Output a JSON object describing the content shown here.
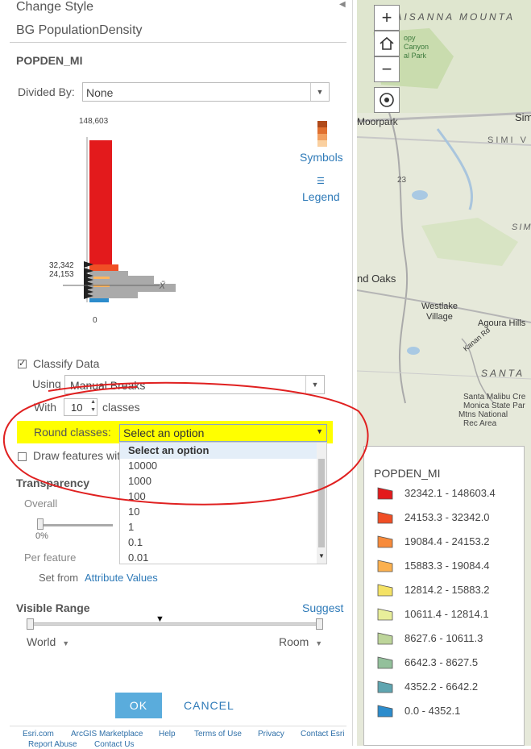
{
  "panel": {
    "header": "Change Style",
    "layer_name": "BG PopulationDensity",
    "field_name": "POPDEN_MI",
    "divided_by_label": "Divided By:",
    "divided_by_value": "None",
    "hist_max": "148,603",
    "hist_min": "0",
    "hist_labels": [
      "32,342",
      "24,153"
    ],
    "symbols_label": "Symbols",
    "legend_label": "Legend",
    "mean_symbol": "x̄",
    "classify_label": "Classify Data",
    "classify_checked": true,
    "using_label": "Using",
    "using_value": "Manual Breaks",
    "with_label": "With",
    "with_value": "10",
    "classes_label": "classes",
    "round_label": "Round classes:",
    "round_value": "Select an option",
    "round_options": [
      "Select an option",
      "10000",
      "1000",
      "100",
      "10",
      "1",
      "0.1",
      "0.01"
    ],
    "draw_label": "Draw features wit",
    "transparency_label": "Transparency",
    "overall_label": "Overall",
    "overall_pct": "0%",
    "overall_value": 0.0,
    "per_feature_label": "Per feature",
    "set_from_label": "Set from",
    "attribute_values_label": "Attribute Values",
    "visible_range_label": "Visible Range",
    "suggest_label": "Suggest",
    "range_min": "World",
    "range_max": "Room",
    "ok_label": "OK",
    "cancel_label": "CANCEL",
    "footer_links": [
      "Esri.com",
      "ArcGIS Marketplace",
      "Help",
      "Terms of Use",
      "Privacy",
      "Contact Esri"
    ],
    "footer_links2": [
      "Report Abuse",
      "Contact Us"
    ]
  },
  "map": {
    "labels": {
      "mountains": "TAISANNA MOUNTA",
      "park1": "opy",
      "park2": "Canyon",
      "park3": "al Park",
      "moorpark": "Moorpark",
      "simi": "Sim",
      "simi_v": "SIMI V",
      "simi2": "SIM",
      "route": "23",
      "oaks": "nd Oaks",
      "westlake1": "Westlake",
      "westlake2": "Village",
      "agoura": "Agoura Hills",
      "kanan": "Kanan Rd",
      "santa": "SANTA",
      "smm1": "Santa Malibu Cre",
      "smm2": "Monica State Par",
      "smm3": "Mtns National",
      "smm4": "Rec Area"
    },
    "legend_title": "POPDEN_MI",
    "legend": [
      {
        "range": "32342.1 - 148603.4",
        "color": "#e31a1c"
      },
      {
        "range": "24153.3 - 32342.0",
        "color": "#f04e25"
      },
      {
        "range": "19084.4 - 24153.2",
        "color": "#f78a3a"
      },
      {
        "range": "15883.3 - 19084.4",
        "color": "#fbb04f"
      },
      {
        "range": "12814.2 - 15883.2",
        "color": "#f4e265"
      },
      {
        "range": "10611.4 - 12814.1",
        "color": "#e8ee9a"
      },
      {
        "range": "8627.6 - 10611.3",
        "color": "#bdd59a"
      },
      {
        "range": "6642.3 - 8627.5",
        "color": "#93c09b"
      },
      {
        "range": "4352.2 - 6642.2",
        "color": "#5fa5b0"
      },
      {
        "range": "0.0 - 4352.1",
        "color": "#2c8ccc"
      }
    ]
  },
  "colors": {
    "accent": "#2e7ab8",
    "ok_button": "#5aacdc",
    "highlight": "#ffff00",
    "annotation": "#e02020"
  }
}
